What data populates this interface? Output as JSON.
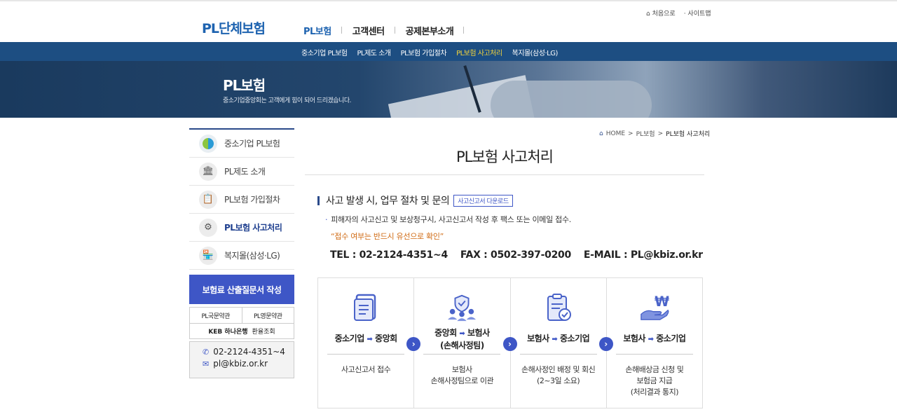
{
  "header": {
    "logo": "PL단체보험",
    "gnb": [
      "PL보험",
      "고객센터",
      "공제본부소개"
    ],
    "util": [
      "⌂ 처음으로",
      "· 사이트맵"
    ]
  },
  "subnav": [
    "중소기업 PL보험",
    "PL제도 소개",
    "PL보험 가입절차",
    "PL보험 사고처리",
    "복지몰(삼성·LG)"
  ],
  "hero": {
    "title": "PL보험",
    "subtitle": "중소기업중앙회는 고객에게 힘이 되어 드리겠습니다."
  },
  "lnb": {
    "items": [
      {
        "label": "중소기업 PL보험",
        "icon": "logo-icon"
      },
      {
        "label": "PL제도 소개",
        "icon": "building-icon"
      },
      {
        "label": "PL보험 가입절차",
        "icon": "clipboard-icon"
      },
      {
        "label": "PL보험 사고처리",
        "icon": "gear-icon"
      },
      {
        "label": "복지몰(삼성·LG)",
        "icon": "store-icon"
      }
    ],
    "cta": "보험료 산출질문서 작성",
    "terms": [
      "PL국문약관",
      "PL영문약관"
    ],
    "bank": "KEB 하나은행",
    "exchange": "환율조회",
    "phone": "02-2124-4351~4",
    "email": "pl@kbiz.or.kr"
  },
  "breadcrumb": [
    "HOME",
    ">",
    "PL보험",
    ">",
    "PL보험 사고처리"
  ],
  "main": {
    "title": "PL보험 사고처리",
    "section_title": "사고 발생 시, 업무 절차 및 문의",
    "download": "사고신고서 다운로드",
    "desc": "피해자의 사고신고 및 보상청구시, 사고신고서 작성 후 팩스 또는 이메일 접수.",
    "note": "“접수 여부는 반드시 유선으로 확인”",
    "tel": "TEL : 02-2124-4351~4",
    "fax": "FAX : 0502-397-0200",
    "email": "E-MAIL : PL@kbiz.or.kr"
  },
  "steps": [
    {
      "from": "중소기업",
      "to": "중앙회",
      "extra": "",
      "body": [
        "사고신고서 접수"
      ],
      "icon": "document-icon"
    },
    {
      "from": "중앙회",
      "to": "보험사",
      "extra": "(손해사정팀)",
      "body": [
        "보험사",
        "손해사정팀으로 이관"
      ],
      "icon": "team-shield-icon"
    },
    {
      "from": "보험사",
      "to": "중소기업",
      "extra": "",
      "body": [
        "손해사정인 배정 및 회신",
        "(2~3일 소요)"
      ],
      "icon": "clipboard-check-icon"
    },
    {
      "from": "보험사",
      "to": "중소기업",
      "extra": "",
      "body": [
        "손해배상금 신청 및",
        "보험금 지급",
        "(처리결과 통지)"
      ],
      "icon": "won-hand-icon"
    }
  ]
}
